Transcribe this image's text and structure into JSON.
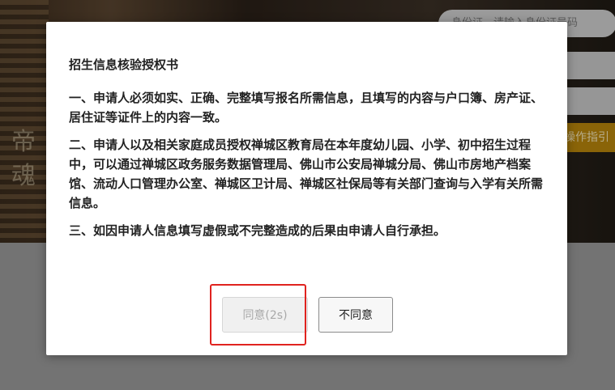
{
  "background": {
    "search_placeholder": "身份证，请输入身份证号码",
    "guide_label": "操作指引",
    "calligraphy": [
      "帝",
      "魂"
    ]
  },
  "modal": {
    "title": "招生信息核验授权书",
    "paragraphs": [
      "一、申请人必须如实、正确、完整填写报名所需信息，且填写的内容与户口簿、房产证、居住证等证件上的内容一致。",
      "二、申请人以及相关家庭成员授权禅城区教育局在本年度幼儿园、小学、初中招生过程中，可以通过禅城区政务服务数据管理局、佛山市公安局禅城分局、佛山市房地产档案馆、流动人口管理办公室、禅城区卫计局、禅城区社保局等有关部门查询与入学有关所需信息。",
      "三、如因申请人信息填写虚假或不完整造成的后果由申请人自行承担。"
    ],
    "agree_label": "同意(2s)",
    "disagree_label": "不同意"
  },
  "colors": {
    "highlight": "#e0231f",
    "guide_bg": "#b8860b"
  }
}
